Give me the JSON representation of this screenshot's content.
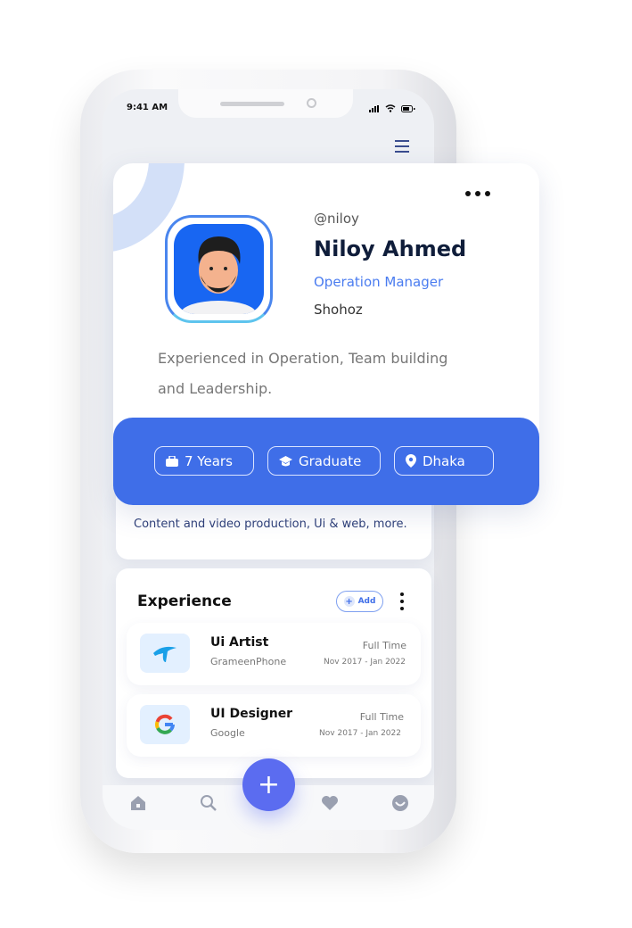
{
  "status_bar": {
    "time": "9:41 AM"
  },
  "profile": {
    "handle": "@niloy",
    "name": "Niloy Ahmed",
    "role": "Operation Manager",
    "company": "Shohoz",
    "bio_line1": "Experienced in Operation, Team building",
    "bio_line2": "and Leadership."
  },
  "chips": [
    {
      "icon": "briefcase-icon",
      "label": "7 Years"
    },
    {
      "icon": "graduation-cap-icon",
      "label": "Graduate"
    },
    {
      "icon": "location-pin-icon",
      "label": "Dhaka"
    }
  ],
  "skills": {
    "text": "Content and video production, Ui & web, more."
  },
  "experience": {
    "title": "Experience",
    "add_label": "Add",
    "items": [
      {
        "title": "Ui Artist",
        "company": "GrameenPhone",
        "type": "Full Time",
        "period": "Nov 2017 - Jan 2022",
        "logo": "grameenphone-logo"
      },
      {
        "title": "UI Designer",
        "company": "Google",
        "type": "Full Time",
        "period": "Nov 2017 - Jan 2022",
        "logo": "google-logo"
      }
    ]
  },
  "nav": [
    "home-icon",
    "search-icon",
    "add-icon",
    "heart-icon",
    "profile-icon"
  ],
  "colors": {
    "accent": "#3f6ee8",
    "fab": "#5b6cf0",
    "name": "#0f1d3a",
    "role": "#4a7cf0"
  }
}
